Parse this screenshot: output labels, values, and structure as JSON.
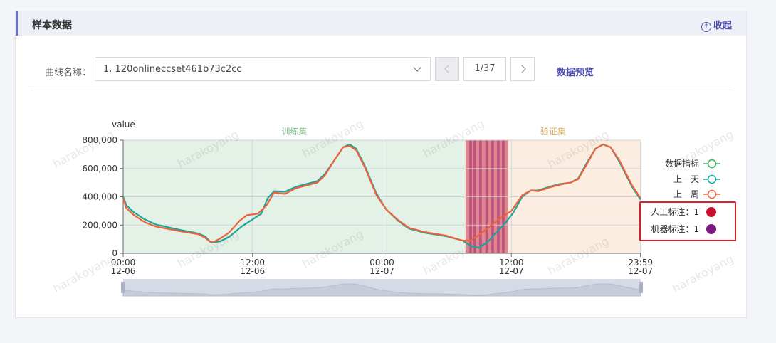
{
  "panel": {
    "title": "样本数据",
    "collapse_label": "收起",
    "collapse_icon": "arrow-up-circle-icon"
  },
  "selector": {
    "label": "曲线名称：",
    "value": "1. 120onlineccset461b73c2cc",
    "page_text": "1/37",
    "preview_label": "数据预览"
  },
  "watermark": "harakoyang",
  "chart_data": {
    "type": "line",
    "y_axis_name": "value",
    "ylim": [
      0,
      800000
    ],
    "y_ticks": [
      "0",
      "200,000",
      "400,000",
      "600,000",
      "800,000"
    ],
    "x_hours_range": [
      0,
      48
    ],
    "x_ticks": [
      {
        "h": 0,
        "time": "00:00",
        "date": "12-06"
      },
      {
        "h": 12,
        "time": "12:00",
        "date": "12-06"
      },
      {
        "h": 24,
        "time": "00:00",
        "date": "12-07"
      },
      {
        "h": 36,
        "time": "12:00",
        "date": "12-07"
      },
      {
        "h": 47.98,
        "time": "23:59",
        "date": "12-07"
      }
    ],
    "regions": [
      {
        "label": "训练集",
        "from": 0,
        "to": 31.75,
        "color": "#e3f1e6",
        "text_color": "#7fb98a"
      },
      {
        "label": "验证集",
        "from": 31.75,
        "to": 47.98,
        "color": "#fbeee0",
        "text_color": "#d8a860"
      }
    ],
    "manual_annotation_band": {
      "from": 31.75,
      "to": 35.7,
      "color": "#d9747f"
    },
    "machine_annotation_band": {
      "from": 32.1,
      "to": 35.4,
      "color": "#a0226e"
    },
    "series": [
      {
        "name": "上一天",
        "color": "#1aa59b",
        "points": [
          [
            0,
            400000
          ],
          [
            0.3,
            340000
          ],
          [
            1,
            290000
          ],
          [
            2,
            240000
          ],
          [
            3,
            205000
          ],
          [
            5,
            170000
          ],
          [
            7,
            140000
          ],
          [
            7.6,
            120000
          ],
          [
            8.1,
            80000
          ],
          [
            8.5,
            80000
          ],
          [
            9,
            85000
          ],
          [
            9.8,
            115000
          ],
          [
            11,
            190000
          ],
          [
            12,
            240000
          ],
          [
            12.8,
            280000
          ],
          [
            13.4,
            390000
          ],
          [
            14,
            440000
          ],
          [
            15,
            435000
          ],
          [
            16,
            470000
          ],
          [
            17,
            490000
          ],
          [
            18,
            510000
          ],
          [
            18.7,
            560000
          ],
          [
            19.6,
            660000
          ],
          [
            20.4,
            750000
          ],
          [
            21,
            770000
          ],
          [
            21.6,
            740000
          ],
          [
            22.4,
            620000
          ],
          [
            23.5,
            420000
          ],
          [
            24.4,
            310000
          ],
          [
            25.5,
            230000
          ],
          [
            26.5,
            175000
          ],
          [
            28,
            145000
          ],
          [
            30,
            120000
          ],
          [
            31,
            100000
          ],
          [
            31.5,
            90000
          ],
          [
            32.3,
            50000
          ],
          [
            33,
            40000
          ],
          [
            33.8,
            80000
          ],
          [
            34.5,
            140000
          ],
          [
            35.5,
            220000
          ],
          [
            36.2,
            290000
          ],
          [
            37,
            400000
          ],
          [
            37.8,
            445000
          ],
          [
            38.5,
            445000
          ],
          [
            39.5,
            470000
          ],
          [
            40.5,
            490000
          ],
          [
            41.5,
            500000
          ],
          [
            42.2,
            530000
          ],
          [
            43,
            640000
          ],
          [
            43.8,
            740000
          ],
          [
            44.5,
            770000
          ],
          [
            45.2,
            750000
          ],
          [
            46,
            650000
          ],
          [
            47.2,
            470000
          ],
          [
            47.98,
            380000
          ]
        ]
      },
      {
        "name": "上一周",
        "color": "#f0603a",
        "points": [
          [
            0,
            390000
          ],
          [
            0.3,
            320000
          ],
          [
            1,
            270000
          ],
          [
            2,
            220000
          ],
          [
            3,
            190000
          ],
          [
            5,
            160000
          ],
          [
            7,
            135000
          ],
          [
            7.6,
            110000
          ],
          [
            8.1,
            80000
          ],
          [
            8.5,
            85000
          ],
          [
            9,
            105000
          ],
          [
            9.8,
            145000
          ],
          [
            10.8,
            230000
          ],
          [
            11.5,
            270000
          ],
          [
            12.5,
            280000
          ],
          [
            13.3,
            340000
          ],
          [
            14,
            430000
          ],
          [
            15,
            420000
          ],
          [
            16,
            460000
          ],
          [
            17,
            480000
          ],
          [
            18,
            500000
          ],
          [
            18.7,
            550000
          ],
          [
            19.6,
            660000
          ],
          [
            20.4,
            750000
          ],
          [
            21,
            760000
          ],
          [
            21.6,
            730000
          ],
          [
            22.4,
            610000
          ],
          [
            23.5,
            410000
          ],
          [
            24.4,
            310000
          ],
          [
            25.5,
            235000
          ],
          [
            26.5,
            180000
          ],
          [
            28,
            150000
          ],
          [
            30,
            125000
          ],
          [
            31,
            100000
          ],
          [
            31.5,
            90000
          ],
          [
            32.2,
            90000
          ],
          [
            33,
            130000
          ],
          [
            34,
            190000
          ],
          [
            35,
            250000
          ],
          [
            36,
            300000
          ],
          [
            37,
            410000
          ],
          [
            37.8,
            445000
          ],
          [
            38.5,
            440000
          ],
          [
            39.5,
            465000
          ],
          [
            40.5,
            485000
          ],
          [
            41.5,
            500000
          ],
          [
            42.2,
            525000
          ],
          [
            43,
            630000
          ],
          [
            43.8,
            740000
          ],
          [
            44.5,
            770000
          ],
          [
            45.2,
            750000
          ],
          [
            46,
            660000
          ],
          [
            47.2,
            480000
          ],
          [
            47.98,
            390000
          ]
        ]
      }
    ],
    "legend": [
      {
        "name": "数据指标",
        "color": "#3fae5a",
        "marker": "open-circle"
      },
      {
        "name": "上一天",
        "color": "#1aa59b",
        "marker": "open-circle"
      },
      {
        "name": "上一周",
        "color": "#f0603a",
        "marker": "open-circle"
      },
      {
        "name": "人工标注：1",
        "color": "#c8102e",
        "marker": "dot"
      },
      {
        "name": "机器标注：1",
        "color": "#7a1a7f",
        "marker": "dot"
      }
    ]
  }
}
